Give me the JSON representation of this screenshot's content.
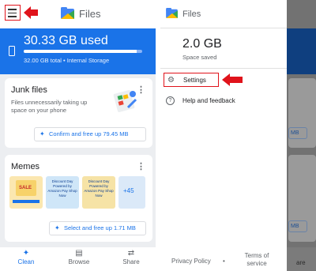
{
  "left": {
    "app_title": "Files",
    "storage": {
      "used": "30.33 GB used",
      "subtitle": "32.00 GB total • Internal Storage",
      "fill_fraction": 0.95
    },
    "junk_card": {
      "title": "Junk files",
      "description": "Files unnecessarily taking up space on your phone",
      "action": "Confirm and free up 79.45 MB"
    },
    "memes_card": {
      "title": "Memes",
      "thumbnails": [
        "Discount Day",
        "Discount Day Powered by Amazon Pay Shop Now",
        "Discount Day Powered by Amazon Pay Shop Now",
        "+45"
      ],
      "sale_label": "SALE",
      "action": "Select and free up 1.71 MB"
    },
    "nav": [
      {
        "label": "Clean",
        "icon": "sparkle-icon",
        "active": true
      },
      {
        "label": "Browse",
        "icon": "browse-icon",
        "active": false
      },
      {
        "label": "Share",
        "icon": "share-icon",
        "active": false
      }
    ]
  },
  "right": {
    "drawer_title": "Files",
    "saved_value": "2.0 GB",
    "saved_label": "Space saved",
    "items": [
      {
        "label": "Settings",
        "icon": "gear-icon"
      },
      {
        "label": "Help and feedback",
        "icon": "help-icon"
      }
    ],
    "footer": {
      "privacy": "Privacy Policy",
      "separator": "•",
      "terms": "Terms of service"
    },
    "background_fragments": [
      "MB",
      "MB",
      "B",
      "are"
    ]
  },
  "colors": {
    "accent": "#1a73e8",
    "annotation_red": "#e0131b"
  }
}
